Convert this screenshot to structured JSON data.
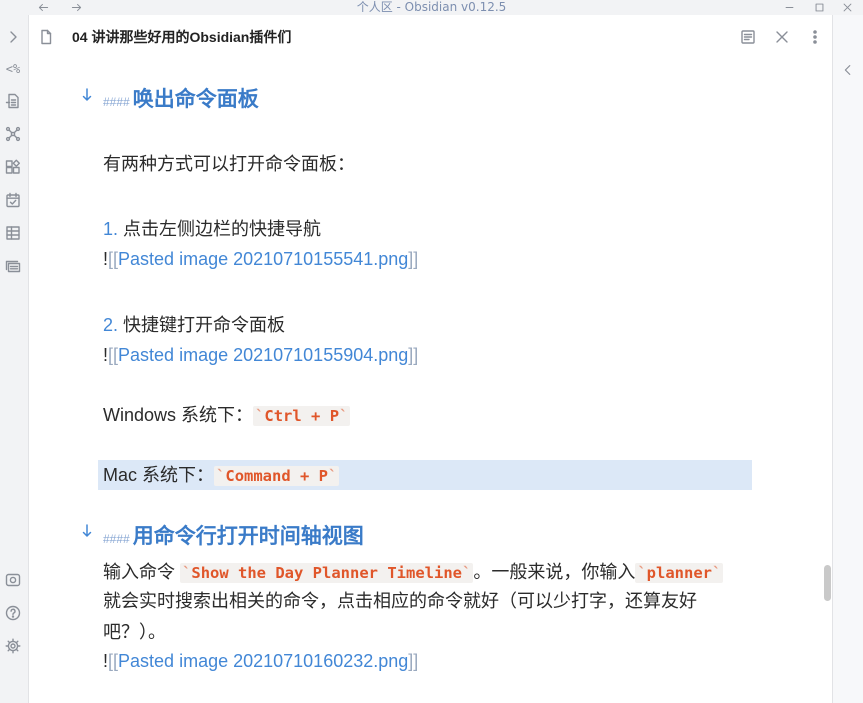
{
  "window": {
    "title": "个人区 - Obsidian v0.12.5",
    "icons": [
      "back-arrow-icon",
      "forward-arrow-icon",
      "minimize-icon",
      "maximize-icon",
      "close-icon"
    ]
  },
  "ribbon": {
    "templater_glyph": "<%",
    "icons": [
      "expand-left-sidebar-icon",
      "templater-icon",
      "open-file-icon",
      "graph-view-icon",
      "plugins-icon",
      "daily-notes-icon",
      "table-icon",
      "slides-icon",
      "vault-icon",
      "help-icon",
      "settings-icon"
    ]
  },
  "tab": {
    "title": "04 讲讲那些好用的Obsidian插件们",
    "icons": [
      "file-icon",
      "reading-view-icon",
      "close-tab-icon",
      "more-options-icon"
    ]
  },
  "right_sidebar": {
    "icons": [
      "expand-right-sidebar-icon"
    ]
  },
  "editor": {
    "heading_marker": "####",
    "code_tick": "`",
    "embed_bang": "!",
    "embed_open": "[[",
    "embed_close": "]]",
    "heading1": "唤出命令面板",
    "intro": "有两种方式可以打开命令面板：",
    "item1": {
      "number": "1.",
      "text": " 点击左侧边栏的快捷导航"
    },
    "embed1": "Pasted image 20210710155541.png",
    "item2": {
      "number": "2.",
      "text": " 快捷键打开命令面板"
    },
    "embed2": "Pasted image 20210710155904.png",
    "windows": {
      "label": "Windows 系统下：",
      "code": "Ctrl + P"
    },
    "mac": {
      "label": "Mac 系统下：",
      "code": "Command + P",
      "active": true
    },
    "heading2": "用命令行打开时间轴视图",
    "para": {
      "line1_before": "输入命令 ",
      "line1_code1": "Show the Day Planner Timeline",
      "line1_middle": "。一般来说，你输入",
      "line1_code2": "planner",
      "line2": "就会实时搜索出相关的命令，点击相应的命令就好（可以少打字，还算友好",
      "line3": "吧？）。"
    },
    "embed3": "Pasted image 20210710160232.png"
  },
  "colors": {
    "accent": "#3a7bc8",
    "heading_marker": "#8aa8d4",
    "link": "#4287d6",
    "list_number": "#4287d6",
    "link_brackets": "#9aa9bf",
    "code_text": "#e0562a",
    "code_bg": "#f3f1ef",
    "active_line": "#dce8f7",
    "text": "#2b2b2b",
    "icon": "#8a8f98",
    "chrome_bg": "#f2f3f5",
    "title_text": "#7d8fb0"
  }
}
